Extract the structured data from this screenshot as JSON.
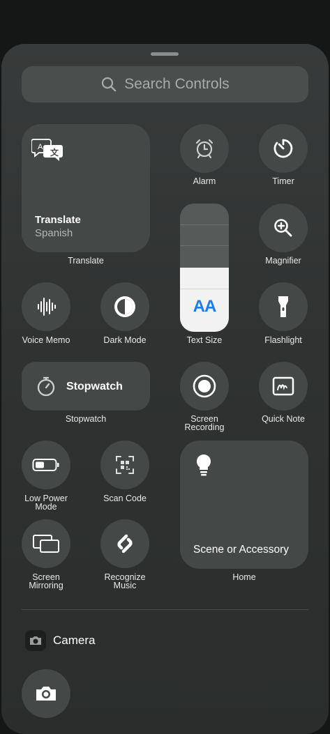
{
  "search": {
    "placeholder": "Search Controls"
  },
  "translate": {
    "title": "Translate",
    "subtitle": "Spanish",
    "caption": "Translate"
  },
  "controls": {
    "alarm": "Alarm",
    "timer": "Timer",
    "magnifier": "Magnifier",
    "text_size": "Text Size",
    "text_size_icon": "AA",
    "text_size_level": 0.5,
    "voice_memo": "Voice Memo",
    "dark_mode": "Dark Mode",
    "flashlight": "Flashlight",
    "stopwatch_title": "Stopwatch",
    "stopwatch_caption": "Stopwatch",
    "screen_recording_1": "Screen",
    "screen_recording_2": "Recording",
    "quick_note": "Quick Note",
    "low_power_1": "Low Power",
    "low_power_2": "Mode",
    "scan_code": "Scan Code",
    "screen_mirroring_1": "Screen",
    "screen_mirroring_2": "Mirroring",
    "recognize_music_1": "Recognize",
    "recognize_music_2": "Music",
    "home_title": "Scene or Accessory",
    "home_caption": "Home"
  },
  "sections": {
    "camera": "Camera"
  },
  "colors": {
    "accent_blue": "#1a7cf5",
    "tile": "#444847",
    "background": "#151716"
  }
}
